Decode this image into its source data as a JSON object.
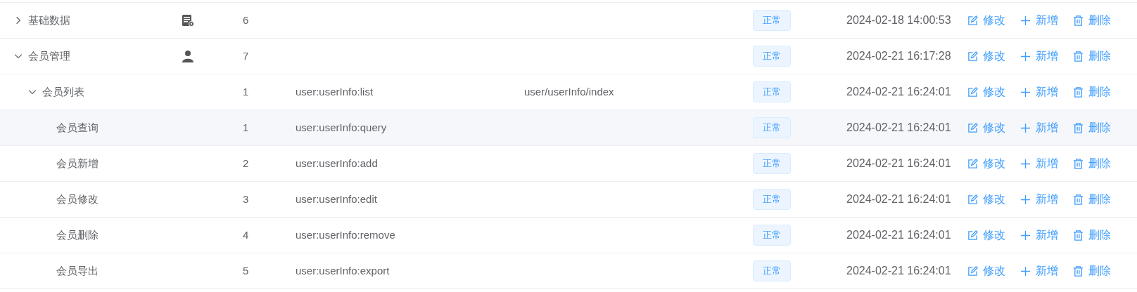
{
  "rows": [
    {
      "name": "基础数据",
      "order": "6",
      "status": "正常",
      "created": "2024-02-18 14:00:53",
      "actions": [
        "修改",
        "新增",
        "删除"
      ],
      "expanded": false
    },
    {
      "name": "会员管理",
      "order": "7",
      "status": "正常",
      "created": "2024-02-21 16:17:28",
      "actions": [
        "修改",
        "新增",
        "删除"
      ],
      "expanded": true,
      "children": [
        {
          "name": "会员列表",
          "order": "1",
          "perms": "user:userInfo:list",
          "component": "user/userInfo/index",
          "status": "正常",
          "created": "2024-02-21 16:24:01",
          "actions": [
            "修改",
            "新增",
            "删除"
          ],
          "expanded": true,
          "children": [
            {
              "name": "会员查询",
              "order": "1",
              "perms": "user:userInfo:query",
              "status": "正常",
              "created": "2024-02-21 16:24:01",
              "actions": [
                "修改",
                "新增",
                "删除"
              ],
              "hovered": true
            },
            {
              "name": "会员新增",
              "order": "2",
              "perms": "user:userInfo:add",
              "status": "正常",
              "created": "2024-02-21 16:24:01",
              "actions": [
                "修改",
                "新增",
                "删除"
              ]
            },
            {
              "name": "会员修改",
              "order": "3",
              "perms": "user:userInfo:edit",
              "status": "正常",
              "created": "2024-02-21 16:24:01",
              "actions": [
                "修改",
                "新增",
                "删除"
              ]
            },
            {
              "name": "会员删除",
              "order": "4",
              "perms": "user:userInfo:remove",
              "status": "正常",
              "created": "2024-02-21 16:24:01",
              "actions": [
                "修改",
                "新增",
                "删除"
              ]
            },
            {
              "name": "会员导出",
              "order": "5",
              "perms": "user:userInfo:export",
              "status": "正常",
              "created": "2024-02-21 16:24:01",
              "actions": [
                "修改",
                "新增",
                "删除"
              ]
            }
          ]
        }
      ]
    }
  ]
}
